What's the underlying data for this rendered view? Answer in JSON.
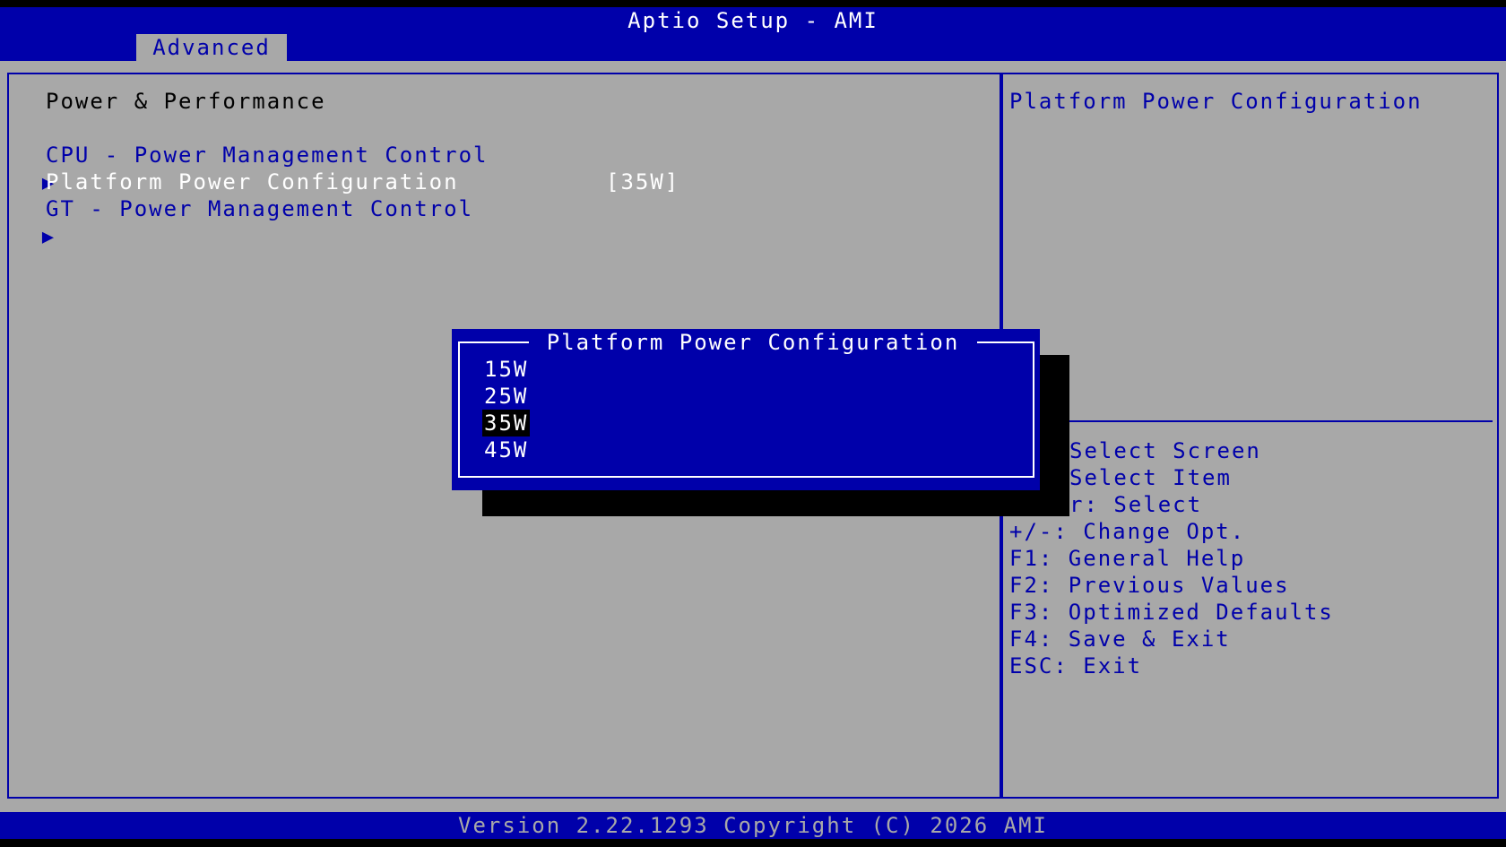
{
  "header": {
    "title": "Aptio Setup - AMI",
    "tab": "Advanced"
  },
  "main": {
    "section_title": "Power & Performance",
    "items": [
      {
        "arrow": "▶",
        "label": "CPU - Power Management Control"
      },
      {
        "label": "Platform Power Configuration",
        "value": "[35W]"
      },
      {
        "arrow": "▶",
        "label": "GT - Power Management Control"
      }
    ]
  },
  "help": {
    "title": "Platform Power Configuration"
  },
  "keys": [
    "Select Screen",
    "Select Item",
    "r: Select",
    "+/-: Change Opt.",
    "F1: General Help",
    "F2: Previous Values",
    "F3: Optimized Defaults",
    "F4: Save & Exit",
    "ESC: Exit"
  ],
  "popup": {
    "title": "Platform Power Configuration",
    "options": [
      "15W",
      "25W",
      "35W",
      "45W"
    ],
    "selected": "35W"
  },
  "footer": {
    "text": "Version 2.22.1293 Copyright (C) 2026 AMI"
  },
  "colors": {
    "bios_blue": "#0000aa",
    "panel_gray": "#a8a8a8",
    "text_white": "#ffffff"
  }
}
